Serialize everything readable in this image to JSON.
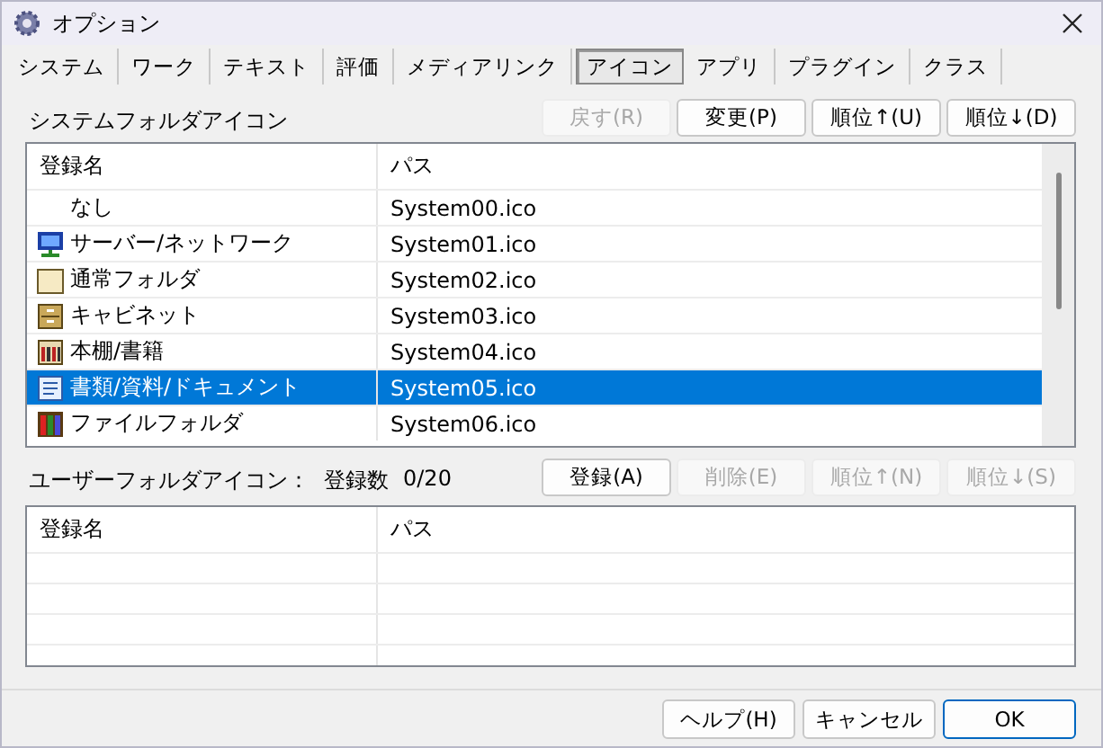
{
  "window": {
    "title": "オプション"
  },
  "tabs": [
    {
      "label": "システム",
      "selected": false
    },
    {
      "label": "ワーク",
      "selected": false
    },
    {
      "label": "テキスト",
      "selected": false
    },
    {
      "label": "評価",
      "selected": false
    },
    {
      "label": "メディアリンク",
      "selected": false
    },
    {
      "label": "アイコン",
      "selected": true
    },
    {
      "label": "アプリ",
      "selected": false
    },
    {
      "label": "プラグイン",
      "selected": false
    },
    {
      "label": "クラス",
      "selected": false
    }
  ],
  "system_section": {
    "label": "システムフォルダアイコン",
    "buttons": [
      {
        "label": "戻す(R)",
        "disabled": true
      },
      {
        "label": "変更(P)",
        "disabled": false
      },
      {
        "label": "順位↑(U)",
        "disabled": false
      },
      {
        "label": "順位↓(D)",
        "disabled": false
      }
    ],
    "columns": [
      "登録名",
      "パス"
    ],
    "rows": [
      {
        "kind": "none",
        "name": "なし",
        "path": "System00.ico",
        "selected": false
      },
      {
        "kind": "network",
        "name": "サーバー/ネットワーク",
        "path": "System01.ico",
        "selected": false
      },
      {
        "kind": "folder",
        "name": "通常フォルダ",
        "path": "System02.ico",
        "selected": false
      },
      {
        "kind": "cabinet",
        "name": "キャビネット",
        "path": "System03.ico",
        "selected": false
      },
      {
        "kind": "bookshelf",
        "name": "本棚/書籍",
        "path": "System04.ico",
        "selected": false
      },
      {
        "kind": "document",
        "name": "書類/資料/ドキュメント",
        "path": "System05.ico",
        "selected": true
      },
      {
        "kind": "binder",
        "name": "ファイルフォルダ",
        "path": "System06.ico",
        "selected": false
      }
    ]
  },
  "user_section": {
    "label": "ユーザーフォルダアイコン：",
    "count_label": "登録数",
    "count": "0/20",
    "buttons": [
      {
        "label": "登録(A)",
        "disabled": false
      },
      {
        "label": "削除(E)",
        "disabled": true
      },
      {
        "label": "順位↑(N)",
        "disabled": true
      },
      {
        "label": "順位↓(S)",
        "disabled": true
      }
    ],
    "columns": [
      "登録名",
      "パス"
    ]
  },
  "footer_buttons": [
    {
      "label": "ヘルプ(H)",
      "default": false
    },
    {
      "label": "キャンセル",
      "default": false
    },
    {
      "label": "OK",
      "default": true
    }
  ]
}
